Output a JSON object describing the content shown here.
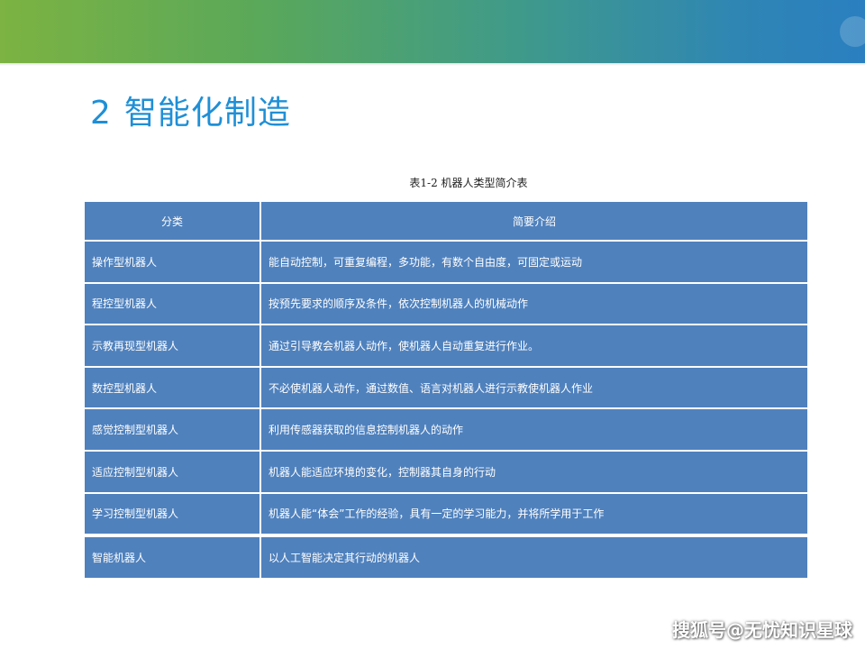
{
  "title": {
    "number": "2",
    "text": "智能化制造"
  },
  "table": {
    "caption": "表1-2  机器人类型简介表",
    "headers": [
      "分类",
      "简要介绍"
    ],
    "rows": [
      {
        "category": "操作型机器人",
        "description": "能自动控制，可重复编程，多功能，有数个自由度，可固定或运动"
      },
      {
        "category": "程控型机器人",
        "description": "按预先要求的顺序及条件，依次控制机器人的机械动作"
      },
      {
        "category": "示教再现型机器人",
        "description": "通过引导教会机器人动作，使机器人自动重复进行作业。"
      },
      {
        "category": "数控型机器人",
        "description": "不必使机器人动作，通过数值、语言对机器人进行示教使机器人作业"
      },
      {
        "category": "感觉控制型机器人",
        "description": "利用传感器获取的信息控制机器人的动作"
      },
      {
        "category": "适应控制型机器人",
        "description": "机器人能适应环境的变化，控制器其自身的行动"
      },
      {
        "category": "学习控制型机器人",
        "description": "机器人能“体会”工作的经验，具有一定的学习能力，并将所学用于工作"
      },
      {
        "category": "智能机器人",
        "description": "以人工智能决定其行动的机器人"
      }
    ]
  },
  "watermark": "搜狐号@无忧知识星球",
  "colors": {
    "banner_start": "#7cb342",
    "banner_end": "#2a7fc0",
    "title": "#1f8fd6",
    "table_fill": "#4f81bd"
  }
}
